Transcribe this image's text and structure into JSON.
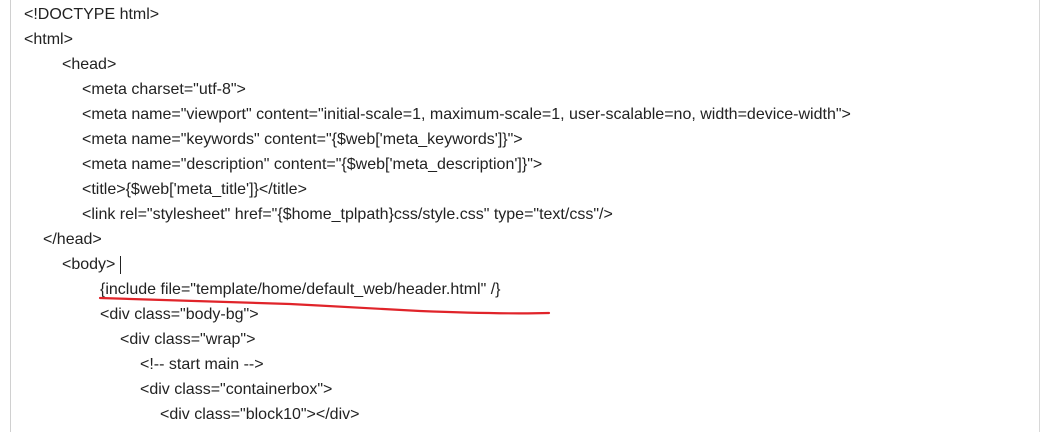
{
  "document": {
    "lines": [
      "<!DOCTYPE html>",
      "<html>",
      "<head>",
      "<meta charset=\"utf-8\">",
      "<meta name=\"viewport\" content=\"initial-scale=1, maximum-scale=1, user-scalable=no, width=device-width\">",
      "<meta name=\"keywords\" content=\"{$web['meta_keywords']}\">",
      "<meta name=\"description\" content=\"{$web['meta_description']}\">",
      "<title>{$web['meta_title']}</title>",
      "<link rel=\"stylesheet\" href=\"{$home_tplpath}css/style.css\" type=\"text/css\"/>",
      "</head>",
      "<body>",
      "{include file=\"template/home/default_web/header.html\" /}",
      "<div class=\"body-bg\">",
      "<div class=\"wrap\">",
      "<!-- start main -->",
      "<div class=\"containerbox\">",
      "<div class=\"block10\"></div>"
    ]
  },
  "annotation": {
    "color": "#e0242a"
  }
}
